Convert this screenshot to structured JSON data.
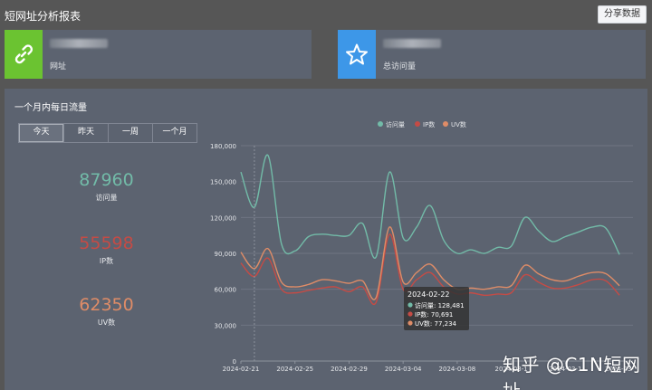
{
  "header": {
    "title": "短网址分析报表",
    "share_label": "分享数据"
  },
  "cards": [
    {
      "label": "网址",
      "icon": "link-icon"
    },
    {
      "label": "总访问量",
      "icon": "star-icon"
    }
  ],
  "panel": {
    "title": "一个月内每日流量",
    "tabs": [
      "今天",
      "昨天",
      "一周",
      "一个月"
    ],
    "active_tab": "今天"
  },
  "kpis": [
    {
      "value": "87960",
      "label": "访问量",
      "color": "#72bba8"
    },
    {
      "value": "55598",
      "label": "IP数",
      "color": "#c54b45"
    },
    {
      "value": "62350",
      "label": "UV数",
      "color": "#df8c67"
    }
  ],
  "chart_data": {
    "type": "line",
    "x": [
      "2024-02-21",
      "2024-02-22",
      "2024-02-23",
      "2024-02-24",
      "2024-02-25",
      "2024-02-26",
      "2024-02-27",
      "2024-02-28",
      "2024-02-29",
      "2024-03-01",
      "2024-03-02",
      "2024-03-03",
      "2024-03-04",
      "2024-03-05",
      "2024-03-06",
      "2024-03-07",
      "2024-03-08",
      "2024-03-09",
      "2024-03-10",
      "2024-03-11",
      "2024-03-12",
      "2024-03-13",
      "2024-03-14",
      "2024-03-15",
      "2024-03-16",
      "2024-03-17",
      "2024-03-18",
      "2024-03-19",
      "2024-03-20",
      "2024-03-21"
    ],
    "x_tick_labels": [
      "2024-02-21",
      "2024-02-25",
      "2024-02-29",
      "2024-03-04",
      "2024-03-08",
      "2024-03-1",
      "2024-03-1",
      "2024-03-"
    ],
    "ylim": [
      0,
      180000
    ],
    "y_ticks": [
      "0",
      "30,000",
      "60,000",
      "90,000",
      "120,000",
      "150,000",
      "180,000"
    ],
    "legend_position": "top",
    "grid": true,
    "series": [
      {
        "name": "访问量",
        "color": "#72bba8",
        "values": [
          158000,
          128481,
          172000,
          98000,
          92000,
          104000,
          106000,
          105000,
          105000,
          115000,
          87000,
          158000,
          103000,
          112000,
          130000,
          101000,
          90000,
          93000,
          90000,
          95000,
          96000,
          120000,
          109000,
          100000,
          104000,
          108000,
          112000,
          111000,
          89000,
          null
        ]
      },
      {
        "name": "IP数",
        "color": "#c54b45",
        "values": [
          82000,
          70691,
          86000,
          60000,
          57000,
          59000,
          61000,
          62000,
          58000,
          62000,
          49000,
          106000,
          60000,
          68000,
          74000,
          62000,
          56000,
          57000,
          55000,
          56000,
          57000,
          72000,
          66000,
          61000,
          61000,
          64000,
          68000,
          67000,
          55000,
          null
        ]
      },
      {
        "name": "UV数",
        "color": "#df8c67",
        "values": [
          91000,
          77234,
          94000,
          66000,
          62000,
          64000,
          68000,
          67000,
          65000,
          67000,
          53000,
          112000,
          66000,
          74000,
          81000,
          68000,
          60000,
          61000,
          60000,
          62000,
          63000,
          80000,
          73000,
          68000,
          67000,
          71000,
          74000,
          73000,
          63000,
          null
        ]
      }
    ],
    "tooltip": {
      "date": "2024-02-22",
      "rows": [
        "访问量: 128,481",
        "IP数: 70,691",
        "UV数: 77,234"
      ]
    }
  },
  "watermark": "知乎 @C1N短网址"
}
